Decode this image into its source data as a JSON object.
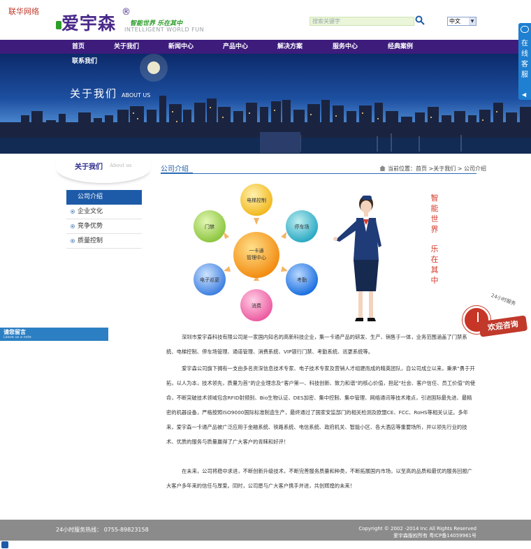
{
  "top_note": "联华网络",
  "logo": {
    "name": "爱宇森",
    "reg": "®",
    "slogan": "智能世界 乐在其中",
    "english": "INTELLIGENT WORLD FUN"
  },
  "search": {
    "placeholder": "搜索关键字"
  },
  "language": {
    "selected": "中文"
  },
  "nav": {
    "items": [
      "首页",
      "关于我们",
      "新闻中心",
      "产品中心",
      "解决方案",
      "服务中心",
      "经典案例"
    ],
    "second_row": "联系我们"
  },
  "banner": {
    "title": "关于我们",
    "subtitle": "ABOUT US"
  },
  "online_service": {
    "label": "在线客服"
  },
  "sidebar": {
    "title": "关于我们",
    "title_en": "About us",
    "items": [
      "公司介绍",
      "企业文化",
      "竞争优势",
      "质量控制"
    ]
  },
  "leave_message": {
    "label": "请您留言",
    "label_en": "Leave us a note"
  },
  "content": {
    "title": "公司介绍",
    "breadcrumb": "当前位置：首页 >关于我们 > 公司介绍",
    "diagram": {
      "center": [
        "一卡通",
        "管理中心"
      ],
      "nodes": [
        "电梯控制",
        "停车场",
        "考勤",
        "消费",
        "电子巡更",
        "门禁"
      ]
    },
    "slogan_top": "智能世界",
    "slogan_bottom": "乐在其中",
    "paragraphs": [
      "深圳市爱宇森科技有限公司是一家国内知名的高新科技企业，集一卡通产品的研发、生产、销售于一体，业务范围涵盖了门禁系统、电梯控制、停车场管理、通道管理、消费系统、VIP银行门禁、考勤系统、巡更系统等。",
      "爱宇森公司旗下拥有一支由多名资深信息技术专家、电子技术专家及营销人才组建而成的精英团队，自公司成立以来，秉承“勇于开拓，以人为本，技术领先，质量为首”的企业理念及“客户第一、科技创新、致力和谐”的核心价值，担起“社会、客户信任、员工价值”的使命，不断突破技术领域包含RFID射频别、Bio生物认证、DES加密、集中控制、集中管理、网络通讯等技术难点，引进国际最先进、最精密的机器设备，严格按照ISO9000国际标准制造生产，最终通过了国家安监部门的相关检测及欧盟CE、FCC、RoHS等相关认证。多年来，爱宇森一卡通产品被广泛应用于金融系统、铁路系统、电信系统、政府机关、智能小区、各大酒店等重要场所，并以领先行业的技术、优质的服务与质量赢得了广大客户的青睐和好评！",
      "在未来，公司将稳中求进，不断创新升级技术，不断完善服务质量和种类，不断拓展国内市场，以至高的品质和最优的服务回报广大客户多年来的信任与厚爱。同时，公司愿与广大客户携手并进，共创辉煌的未来！"
    ]
  },
  "consult": {
    "caption": "24小时服务",
    "label": "欢迎咨询"
  },
  "footer": {
    "hotline": "24小时服务热线：  0755-89823158",
    "copyright": "Copyright © 2002 -2014   Inc All Rights Reserved",
    "icp": "爱宇森版权所有  粤ICP备14059961号"
  },
  "colors": {
    "nav_bg": "#3d1c7c",
    "accent_blue": "#1d5ba8",
    "slogan_red": "#d63a2a",
    "footer_bg": "#8b8b8b"
  }
}
